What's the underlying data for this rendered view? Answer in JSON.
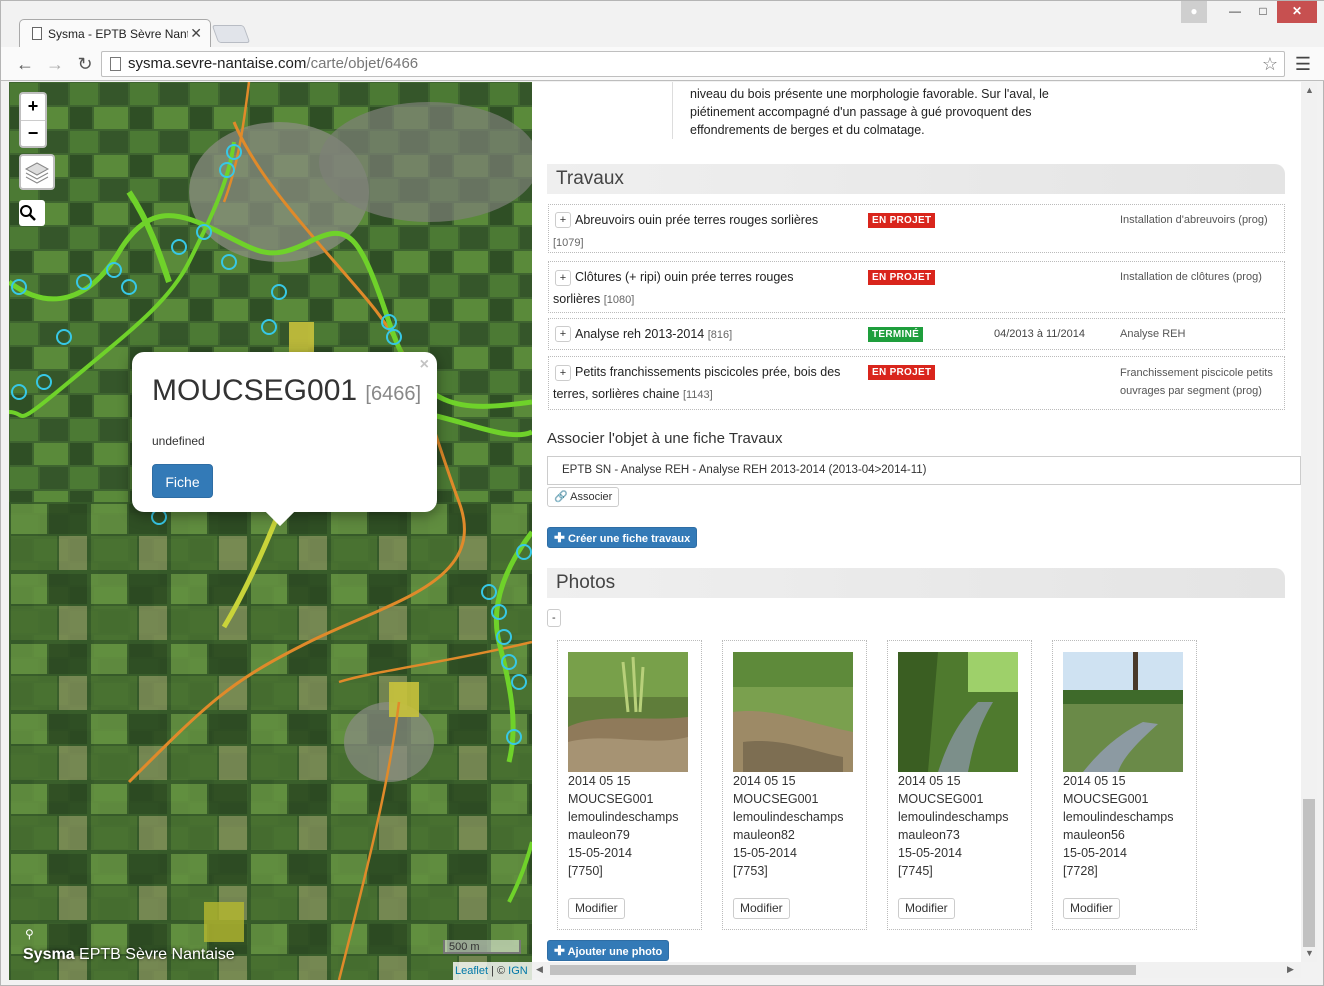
{
  "browser": {
    "tab_title": "Sysma - EPTB Sèvre Nanta",
    "url_host": "sysma.sevre-nantaise.com",
    "url_path": "/carte/objet/6466"
  },
  "map": {
    "zoom_in": "+",
    "zoom_out": "−",
    "popup": {
      "title": "MOUCSEG001",
      "id": "[6466]",
      "subtitle": "undefined",
      "button": "Fiche"
    },
    "brand_prefix": "Sysma",
    "brand_suffix": "EPTB Sèvre Nantaise",
    "scale": "500 m",
    "attribution_leaflet": "Leaflet",
    "attribution_sep": " | © ",
    "attribution_ign": "IGN"
  },
  "panel": {
    "description": "niveau du bois présente une morphologie favorable. Sur l'aval, le piétinement accompagné d'un passage à gué provoquent des effondrements de berges et du colmatage.",
    "travaux_title": "Travaux",
    "travaux": [
      {
        "name": "Abreuvoirs ouin prée terres rouges sorlières",
        "id": "[1079]",
        "status": "EN PROJET",
        "status_color": "#d9251c",
        "dates": "",
        "type": "Installation d'abreuvoirs (prog)"
      },
      {
        "name": "Clôtures (+ ripi) ouin prée terres rouges sorlières",
        "id": "[1080]",
        "status": "EN PROJET",
        "status_color": "#d9251c",
        "dates": "",
        "type": "Installation de clôtures (prog)"
      },
      {
        "name": "Analyse reh 2013-2014",
        "id": "[816]",
        "status": "TERMINÉ",
        "status_color": "#1e9e3c",
        "dates": "04/2013 à 11/2014",
        "type": "Analyse REH"
      },
      {
        "name": "Petits franchissements piscicoles prée, bois des terres, sorlières chaine",
        "id": "[1143]",
        "status": "EN PROJET",
        "status_color": "#d9251c",
        "dates": "",
        "type": "Franchissement piscicole petits ouvrages par segment (prog)"
      }
    ],
    "assoc_label": "Associer l'objet à une fiche Travaux",
    "assoc_value": "EPTB SN - Analyse REH - Analyse REH 2013-2014 (2013-04>2014-11)",
    "assoc_button": "Associer",
    "create_button": "Créer une fiche travaux",
    "photos_title": "Photos",
    "photos_toggle": "-",
    "photos": [
      {
        "date": "2014 05 15",
        "object": "MOUCSEG001",
        "place": "lemoulindeschamps",
        "file": "mauleon79",
        "taken": "15-05-2014",
        "id": "[7750]",
        "edit": "Modifier"
      },
      {
        "date": "2014 05 15",
        "object": "MOUCSEG001",
        "place": "lemoulindeschamps",
        "file": "mauleon82",
        "taken": "15-05-2014",
        "id": "[7753]",
        "edit": "Modifier"
      },
      {
        "date": "2014 05 15",
        "object": "MOUCSEG001",
        "place": "lemoulindeschamps",
        "file": "mauleon73",
        "taken": "15-05-2014",
        "id": "[7745]",
        "edit": "Modifier"
      },
      {
        "date": "2014 05 15",
        "object": "MOUCSEG001",
        "place": "lemoulindeschamps",
        "file": "mauleon56",
        "taken": "15-05-2014",
        "id": "[7728]",
        "edit": "Modifier"
      }
    ],
    "add_photo_button": "Ajouter une photo"
  }
}
